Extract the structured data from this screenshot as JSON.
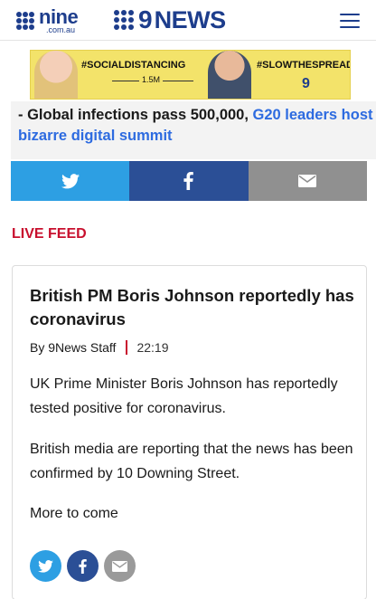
{
  "header": {
    "nine_logo_word": "nine",
    "nine_logo_sub": ".com.au",
    "news_logo_nine": "9",
    "news_logo_word": "NEWS",
    "menu_icon": "hamburger-icon"
  },
  "banner": {
    "tag_left": "#SOCIALDISTANCING",
    "tag_right": "#SLOWTHESPREAD",
    "distance": "1.5M",
    "logo": "9"
  },
  "headline": {
    "dark_text": "- Global infections pass 500,000, ",
    "link_text": "G20 leaders host bizarre digital summit"
  },
  "share_bar": {
    "icons": [
      "twitter-icon",
      "facebook-icon",
      "email-icon"
    ],
    "colors": {
      "twitter": "#2d9fe3",
      "facebook": "#2b4f96",
      "email": "#909090"
    }
  },
  "live_feed": {
    "label": "LIVE FEED",
    "color": "#c8102e"
  },
  "post": {
    "title": "British PM Boris Johnson reportedly has coronavirus",
    "author": "By 9News Staff",
    "time": "22:19",
    "paragraphs": [
      "UK Prime Minister Boris Johnson has reportedly tested positive for coronavirus.",
      "British media are reporting that the news has been confirmed by 10 Downing Street.",
      "More to come"
    ]
  }
}
